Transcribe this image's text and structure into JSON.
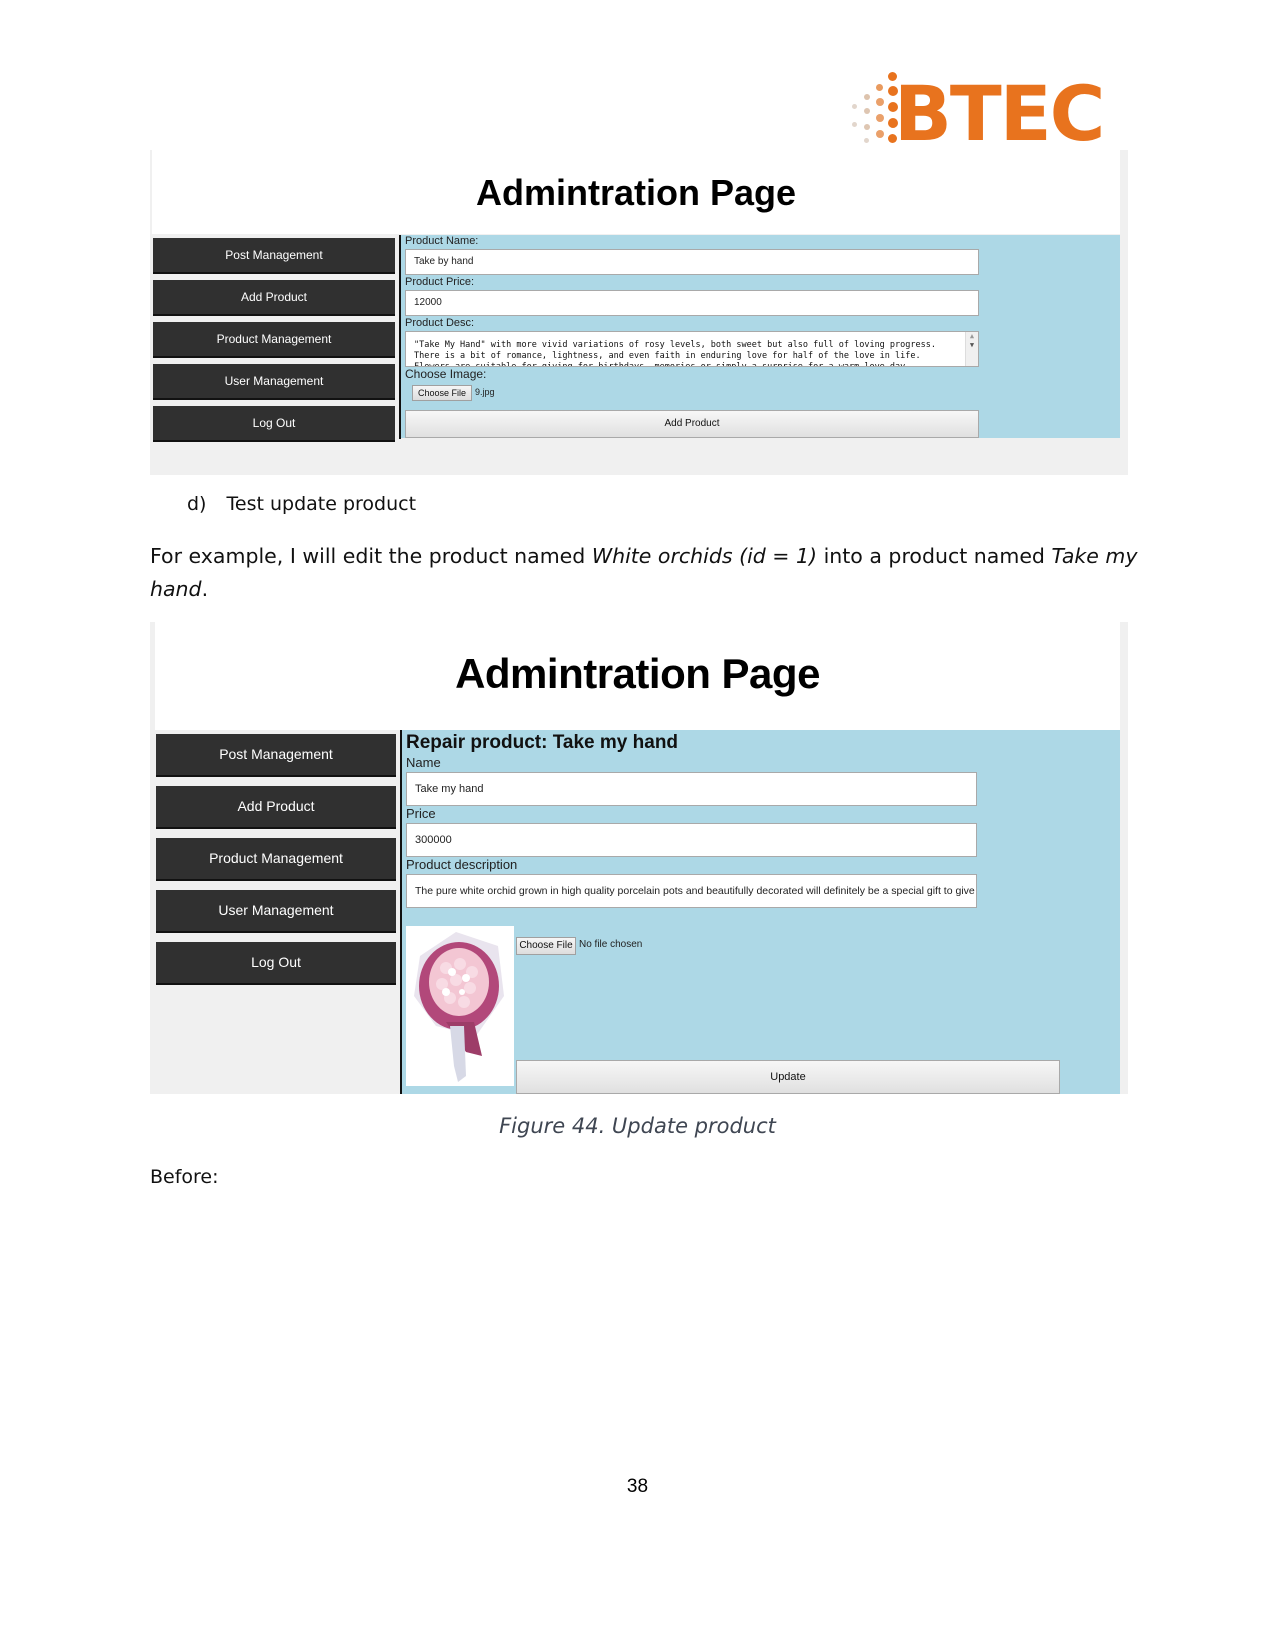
{
  "logo": {
    "text": "BTEC",
    "color": "#e8731e"
  },
  "figure_top": {
    "page_title": "Admintration Page",
    "sidebar": [
      "Post Management",
      "Add Product",
      "Product Management",
      "User Management",
      "Log Out"
    ],
    "form": {
      "name_label": "Product Name:",
      "name_value": "Take by hand",
      "price_label": "Product Price:",
      "price_value": "12000",
      "desc_label": "Product Desc:",
      "desc_lines": [
        "\"Take My Hand\" with more vivid variations of rosy levels, both sweet but also full of loving progress.",
        "There is a bit of romance, lightness, and even faith in enduring love for half of the love in life.",
        "Flowers are suitable for giving for birthdays, memories or simply a surprise for a warm love day."
      ],
      "image_label": "Choose Image:",
      "file_button": "Choose File",
      "file_name": "9.jpg",
      "submit_label": "Add Product"
    }
  },
  "section_heading": {
    "marker": "d)",
    "text": "Test update product"
  },
  "paragraph": {
    "part1": "For example, I will edit the product named ",
    "italic1": "White orchids (id = 1)",
    "part2": " into a product named ",
    "italic2": "Take my",
    "line2_italic": "hand",
    "line2_end": "."
  },
  "figure_bottom": {
    "page_title": "Admintration Page",
    "sidebar": [
      "Post Management",
      "Add Product",
      "Product Management",
      "User Management",
      "Log Out"
    ],
    "form": {
      "heading": "Repair product: Take my hand",
      "name_label": "Name",
      "name_value": "Take my hand",
      "price_label": "Price",
      "price_value": "300000",
      "desc_label": "Product description",
      "desc_value": "The pure white orchid grown in high quality porcelain pots and beautifully decorated will definitely be a special gift to give to each",
      "file_button": "Choose File",
      "file_status": "No file chosen",
      "submit_label": "Update"
    }
  },
  "caption": "Figure 44. Update product",
  "before_label": "Before:",
  "page_number": "38"
}
